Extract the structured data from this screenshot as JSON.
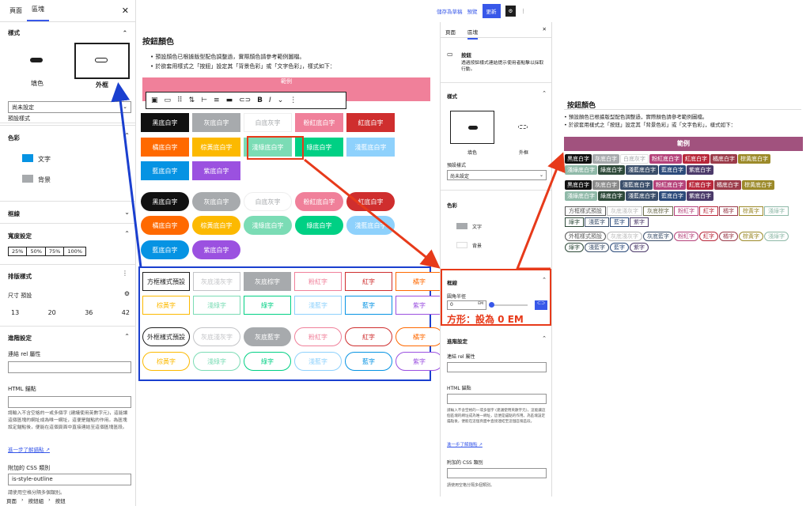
{
  "left": {
    "tab_page": "頁面",
    "tab_block": "區塊",
    "styles_title": "樣式",
    "style_fill": "填色",
    "style_outline": "外框",
    "default_style_label": "預設樣式",
    "default_style_value": "尚未設定",
    "color_title": "色彩",
    "color_text": "文字",
    "color_bg": "背景",
    "border_title": "框線",
    "width_title": "寬度設定",
    "widths": [
      "25%",
      "50%",
      "75%",
      "100%"
    ],
    "typo_title": "排版樣式",
    "size_label": "尺寸",
    "size_default": "預設",
    "sizes": [
      "13",
      "20",
      "36",
      "42"
    ],
    "advanced_title": "進階設定",
    "rel_label": "連結 rel 屬性",
    "anchor_label": "HTML 錨點",
    "anchor_help": "請輸入不含空格的一或多個字 (建議使用英數字元)，這能讓這個區塊的網址成為唯一網址，這便是錨點的作用。為區塊設定錨點後，便能在這個頁面中直接連結至這個區塊區段。",
    "more_link": "進一步了解錨點",
    "css_label": "附加的 CSS 類別",
    "css_value": "is-style-outline",
    "css_help": "請使用空格分隔多個類別。",
    "breadcrumb": [
      "頁面",
      "按鈕組",
      "按鈕"
    ]
  },
  "editor": {
    "title": "按鈕顏色",
    "bullets": [
      "預設顏色已根據版型配色調整過，實際顏色請參考範例圖檔。",
      "於欲套用樣式之「按鈕」設定其「背景色彩」或「文字色彩」，樣式如下："
    ],
    "banner": "範例",
    "fill_row1": [
      [
        "黑底白字",
        "#111111",
        "#ffffff"
      ],
      [
        "灰底白字",
        "#a7aaad",
        "#ffffff"
      ],
      [
        "白底灰字",
        "#ffffff",
        "#a7aaad"
      ],
      [
        "粉紅底白字",
        "#f0809a",
        "#ffffff"
      ],
      [
        "紅底白字",
        "#cf2e2e",
        "#ffffff"
      ]
    ],
    "fill_row2": [
      [
        "橘底白字",
        "#ff6900",
        "#ffffff"
      ],
      [
        "棕黃底白字",
        "#fcb900",
        "#ffffff"
      ],
      [
        "淺綠底白字",
        "#7bdcb5",
        "#ffffff"
      ],
      [
        "綠底白字",
        "#00d084",
        "#ffffff"
      ],
      [
        "淺藍底白字",
        "#8ed1fc",
        "#ffffff"
      ]
    ],
    "fill_row3": [
      [
        "藍底白字",
        "#0693e3",
        "#ffffff"
      ],
      [
        "紫底白字",
        "#9b51e0",
        "#ffffff"
      ]
    ],
    "outline_row1": [
      [
        "方框樣式預設",
        "#1e1e1e",
        "#ffffff"
      ],
      [
        "灰底淺灰字",
        "#c3c4c7",
        "#ffffff"
      ],
      [
        "灰底棕字",
        "#a7aaad",
        "#a7aaad"
      ],
      [
        "粉紅字",
        "#f0809a",
        "#ffffff"
      ],
      [
        "紅字",
        "#cf2e2e",
        "#ffffff"
      ],
      [
        "橘字",
        "#ff6900",
        "#ffffff"
      ]
    ],
    "outline_row2": [
      [
        "棕黃字",
        "#fcb900",
        "#ffffff"
      ],
      [
        "淺綠字",
        "#7bdcb5",
        "#ffffff"
      ],
      [
        "綠字",
        "#00d084",
        "#ffffff"
      ],
      [
        "淺藍字",
        "#8ed1fc",
        "#ffffff"
      ],
      [
        "藍字",
        "#0693e3",
        "#ffffff"
      ],
      [
        "紫字",
        "#9b51e0",
        "#ffffff"
      ]
    ],
    "outline_row3": [
      [
        "外框樣式預設",
        "#1e1e1e",
        "#ffffff"
      ],
      [
        "灰底淺灰字",
        "#c3c4c7",
        "#ffffff"
      ],
      [
        "灰底藍字",
        "#a7aaad",
        "#a7aaad"
      ],
      [
        "粉紅字",
        "#f0809a",
        "#ffffff"
      ],
      [
        "紅字",
        "#cf2e2e",
        "#ffffff"
      ],
      [
        "橘字",
        "#ff6900",
        "#ffffff"
      ]
    ],
    "outline_row4": [
      [
        "棕黃字",
        "#fcb900",
        "#ffffff"
      ],
      [
        "淺綠字",
        "#7bdcb5",
        "#ffffff"
      ],
      [
        "綠字",
        "#00d084",
        "#ffffff"
      ],
      [
        "淺藍字",
        "#8ed1fc",
        "#ffffff"
      ],
      [
        "藍字",
        "#0693e3",
        "#ffffff"
      ],
      [
        "紫字",
        "#9b51e0",
        "#ffffff"
      ]
    ],
    "toolbar_save": "儲存為草稿",
    "toolbar_preview": "預覽",
    "toolbar_update": "更新"
  },
  "right": {
    "tab_page": "頁面",
    "tab_block": "區塊",
    "block_name": "按鈕",
    "block_desc": "透過按鈕樣式連結提示使用者點擊以採取行動。",
    "styles_title": "樣式",
    "style_fill": "填色",
    "style_outline": "外框",
    "default_style_label": "預設樣式",
    "default_style_value": "尚未設定",
    "color_title": "色彩",
    "color_text": "文字",
    "color_bg": "背景",
    "border_title": "框線",
    "radius_label": "圓角半徑",
    "radius_value": "0",
    "radius_unit": "EM",
    "annotation": "方形：設為 0 EM",
    "advanced_title": "進階設定",
    "rel_label": "連結 rel 屬性",
    "anchor_label": "HTML 錨點",
    "anchor_help": "請輸入不含空格的一或多個字 (建議使用英數字元)，這能讓這個區塊的網址成為唯一網址，這便是錨點的作用。為區塊設定錨點後，便能在這個頁面中直接連結至這個區塊區段。",
    "more_link": "進一步了解錨點",
    "css_label": "附加的 CSS 類別",
    "css_help": "請使用空格分隔多個類別。"
  },
  "preview": {
    "title": "按鈕顏色",
    "bullets": [
      "預設顏色已根據版型配色調整過，實際顏色請參考範例圖檔。",
      "於欲套用樣式之「按鈕」設定其「背景色彩」或「文字色彩」，樣式如下："
    ],
    "banner": "範例",
    "fill_a": [
      [
        "黑底白字",
        "#111111",
        "#fff"
      ],
      [
        "灰底白字",
        "#a7aaad",
        "#fff"
      ],
      [
        "白底灰字",
        "#ffffff",
        "#a7aaad"
      ],
      [
        "粉紅底白字",
        "#b5427a",
        "#fff"
      ],
      [
        "紅底白字",
        "#b8273a",
        "#fff"
      ],
      [
        "橘底白字",
        "#9b3c4a",
        "#fff"
      ],
      [
        "棕黃底白字",
        "#9c8a2a",
        "#fff"
      ]
    ],
    "fill_b": [
      [
        "淺綠底白字",
        "#8fb9a8",
        "#fff"
      ],
      [
        "綠底白字",
        "#2e4a3a",
        "#fff"
      ],
      [
        "淺藍底白字",
        "#3a4e6a",
        "#fff"
      ],
      [
        "藍底白字",
        "#2b4a7a",
        "#fff"
      ],
      [
        "紫底白字",
        "#4b3a6a",
        "#fff"
      ]
    ],
    "fill_c": [
      [
        "黑底白字",
        "#111111",
        "#fff"
      ],
      [
        "灰底白字",
        "#8a8a8a",
        "#fff"
      ],
      [
        "淺藍底白字",
        "#3a4e6a",
        "#fff"
      ],
      [
        "粉紅底白字",
        "#b5427a",
        "#fff"
      ],
      [
        "紅底白字",
        "#b8273a",
        "#fff"
      ],
      [
        "橘底白字",
        "#9b3c4a",
        "#fff"
      ],
      [
        "棕黃底白字",
        "#9c8a2a",
        "#fff"
      ]
    ],
    "fill_d": [
      [
        "淺綠底白字",
        "#8fb9a8",
        "#fff"
      ],
      [
        "綠底白字",
        "#2e4a3a",
        "#fff"
      ],
      [
        "淺藍底白字",
        "#3a4e6a",
        "#fff"
      ],
      [
        "藍底白字",
        "#2b4a7a",
        "#fff"
      ],
      [
        "紫底白字",
        "#4b3a6a",
        "#fff"
      ]
    ],
    "ol_a": [
      [
        "方框樣式預設",
        "#555"
      ],
      [
        "灰底淺灰字",
        "#bbb"
      ],
      [
        "灰底棕字",
        "#6a6a4a"
      ],
      [
        "粉紅字",
        "#b5427a"
      ],
      [
        "紅字",
        "#b8273a"
      ],
      [
        "橘字",
        "#9b3c4a"
      ],
      [
        "棕黃字",
        "#9c8a2a"
      ],
      [
        "淺綠字",
        "#8fb9a8"
      ]
    ],
    "ol_b": [
      [
        "綠字",
        "#2e4a3a"
      ],
      [
        "淺藍字",
        "#3a4e6a"
      ],
      [
        "藍字",
        "#2b4a7a"
      ],
      [
        "紫字",
        "#4b3a6a"
      ]
    ],
    "ol_c": [
      [
        "外框樣式預設",
        "#555"
      ],
      [
        "灰底淺灰字",
        "#bbb"
      ],
      [
        "灰底藍字",
        "#3a4e6a"
      ],
      [
        "粉紅字",
        "#b5427a"
      ],
      [
        "紅字",
        "#b8273a"
      ],
      [
        "橘字",
        "#9b3c4a"
      ],
      [
        "棕黃字",
        "#9c8a2a"
      ],
      [
        "淺綠字",
        "#8fb9a8"
      ]
    ],
    "ol_d": [
      [
        "綠字",
        "#2e4a3a"
      ],
      [
        "淺藍字",
        "#3a4e6a"
      ],
      [
        "藍字",
        "#2b4a7a"
      ],
      [
        "紫字",
        "#4b3a6a"
      ]
    ]
  }
}
